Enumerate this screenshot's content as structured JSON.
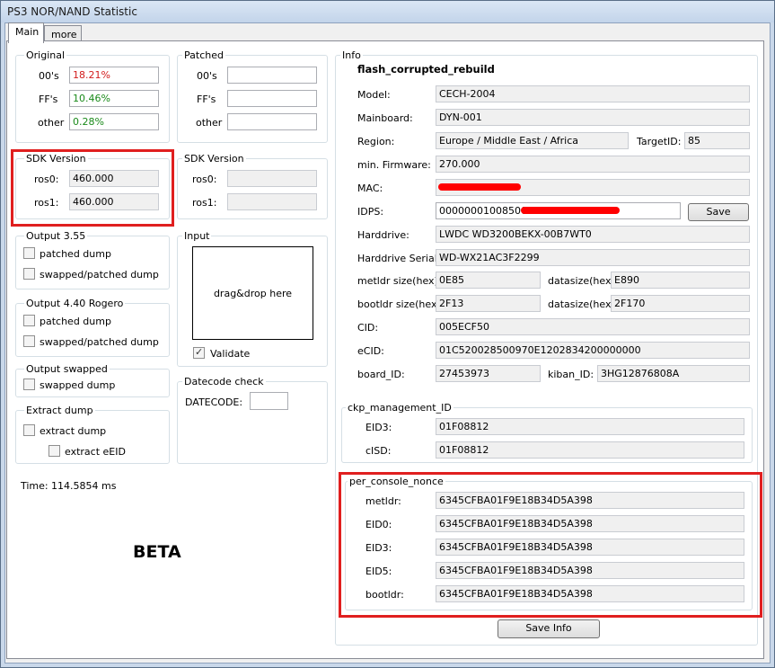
{
  "window": {
    "title": "PS3 NOR/NAND Statistic"
  },
  "tabs": [
    {
      "label": "Main"
    },
    {
      "label": "more"
    }
  ],
  "original": {
    "title": "Original",
    "rows": [
      {
        "label": "00's",
        "value": "18.21%",
        "color": "#d21c1c"
      },
      {
        "label": "FF's",
        "value": "10.46%",
        "color": "#1a8a1a"
      },
      {
        "label": "other",
        "value": "0.28%",
        "color": "#1a8a1a"
      }
    ]
  },
  "patched": {
    "title": "Patched",
    "rows": [
      {
        "label": "00's",
        "value": ""
      },
      {
        "label": "FF's",
        "value": ""
      },
      {
        "label": "other",
        "value": ""
      }
    ]
  },
  "sdk_left": {
    "title": "SDK Version",
    "rows": [
      {
        "label": "ros0:",
        "value": "460.000"
      },
      {
        "label": "ros1:",
        "value": "460.000"
      }
    ]
  },
  "sdk_right": {
    "title": "SDK Version",
    "rows": [
      {
        "label": "ros0:",
        "value": ""
      },
      {
        "label": "ros1:",
        "value": ""
      }
    ]
  },
  "output355": {
    "title": "Output 3.55",
    "options": [
      {
        "label": "patched dump",
        "checked": false
      },
      {
        "label": "swapped/patched dump",
        "checked": false
      }
    ]
  },
  "output440": {
    "title": "Output 4.40 Rogero",
    "options": [
      {
        "label": "patched dump",
        "checked": false
      },
      {
        "label": "swapped/patched dump",
        "checked": false
      }
    ]
  },
  "output_swapped": {
    "title": "Output swapped",
    "options": [
      {
        "label": "swapped dump",
        "checked": false
      }
    ]
  },
  "extract_dump": {
    "title": "Extract dump",
    "options": [
      {
        "label": "extract dump",
        "checked": false
      },
      {
        "label": "extract eEID",
        "checked": false
      }
    ]
  },
  "input": {
    "title": "Input",
    "drop_text": "drag&drop here",
    "validate_label": "Validate",
    "validate_checked": true
  },
  "datecode": {
    "title": "Datecode check",
    "label": "DATECODE:",
    "value": ""
  },
  "time": {
    "label": "Time:",
    "value": "114.5854 ms"
  },
  "beta_label": "BETA",
  "info": {
    "title": "Info",
    "heading": "flash_corrupted_rebuild",
    "model": {
      "label": "Model:",
      "value": "CECH-2004"
    },
    "mainboard": {
      "label": "Mainboard:",
      "value": "DYN-001"
    },
    "region": {
      "label": "Region:",
      "value": "Europe / Middle East / Africa"
    },
    "targetid": {
      "label": "TargetID:",
      "value": "85"
    },
    "min_firmware": {
      "label": "min. Firmware:",
      "value": "270.000"
    },
    "mac": {
      "label": "MAC:",
      "value": ""
    },
    "idps": {
      "label": "IDPS:",
      "value": "00000001008500091"
    },
    "save_label": "Save",
    "harddrive": {
      "label": "Harddrive:",
      "value": "ᒪWDC WD3200BEKX-00B7WT0"
    },
    "harddrive_serial": {
      "label": "Harddrive Serial:",
      "value": "WD-WX21AC3F2299"
    },
    "metldr_size": {
      "label": "metldr size(hex):",
      "value": "0E85"
    },
    "metldr_datasize": {
      "label": "datasize(hex):",
      "value": "E890"
    },
    "bootldr_size": {
      "label": "bootldr size(hex):",
      "value": "2F13"
    },
    "bootldr_datasize": {
      "label": "datasize(hex):",
      "value": "2F170"
    },
    "cid": {
      "label": "CID:",
      "value": "005ECF50"
    },
    "ecid": {
      "label": "eCID:",
      "value": "01C520028500970E1202834200000000"
    },
    "board_id": {
      "label": "board_ID:",
      "value": "27453973"
    },
    "kiban_id": {
      "label": "kiban_ID:",
      "value": "3HG12876808A"
    }
  },
  "ckp": {
    "title": "ckp_management_ID",
    "rows": [
      {
        "label": "EID3:",
        "value": "01F08812"
      },
      {
        "label": "cISD:",
        "value": "01F08812"
      }
    ]
  },
  "nonce": {
    "title": "per_console_nonce",
    "rows": [
      {
        "label": "metldr:",
        "value": "6345CFBA01F9E18B34D5A398"
      },
      {
        "label": "EID0:",
        "value": "6345CFBA01F9E18B34D5A398"
      },
      {
        "label": "EID3:",
        "value": "6345CFBA01F9E18B34D5A398"
      },
      {
        "label": "EID5:",
        "value": "6345CFBA01F9E18B34D5A398"
      },
      {
        "label": "bootldr:",
        "value": "6345CFBA01F9E18B34D5A398"
      }
    ]
  },
  "save_info_label": "Save Info",
  "colors": {
    "highlight_box": "#e01f1f",
    "redaction": "#ff0000"
  }
}
